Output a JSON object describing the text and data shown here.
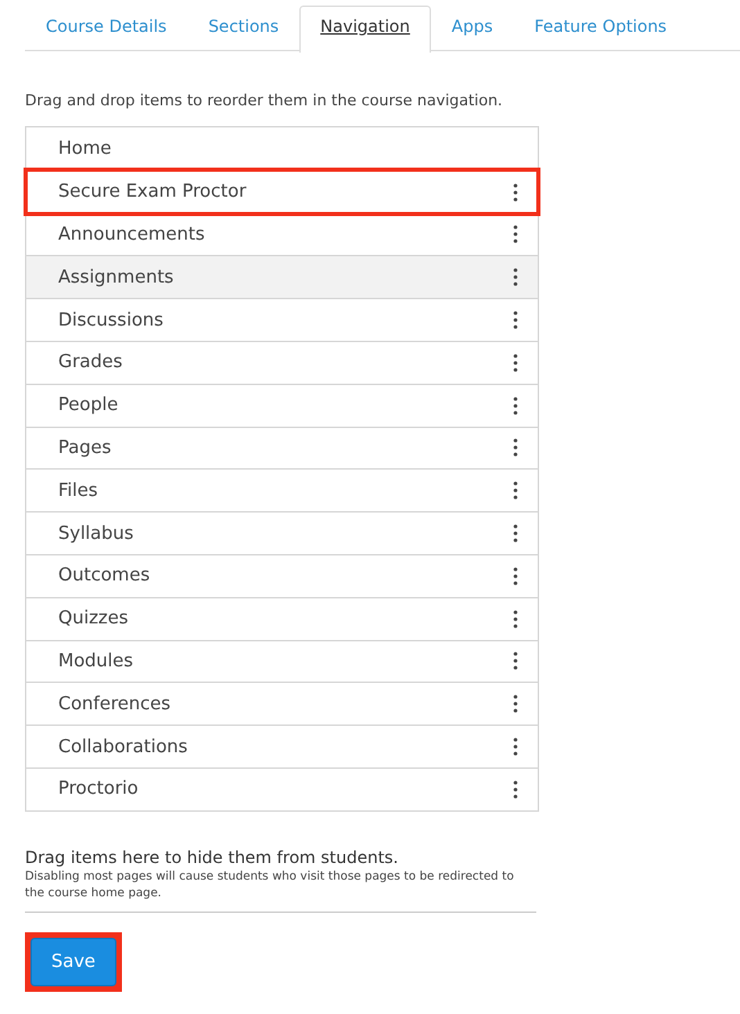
{
  "tabs": [
    {
      "label": "Course Details",
      "selected": false
    },
    {
      "label": "Sections",
      "selected": false
    },
    {
      "label": "Navigation",
      "selected": true
    },
    {
      "label": "Apps",
      "selected": false
    },
    {
      "label": "Feature Options",
      "selected": false
    }
  ],
  "instructions": "Drag and drop items to reorder them in the course navigation.",
  "nav_items": [
    {
      "label": "Home",
      "draggable": false,
      "highlighted": false,
      "shaded": false
    },
    {
      "label": "Secure Exam Proctor",
      "draggable": true,
      "highlighted": true,
      "shaded": false
    },
    {
      "label": "Announcements",
      "draggable": true,
      "highlighted": false,
      "shaded": false
    },
    {
      "label": "Assignments",
      "draggable": true,
      "highlighted": false,
      "shaded": true
    },
    {
      "label": "Discussions",
      "draggable": true,
      "highlighted": false,
      "shaded": false
    },
    {
      "label": "Grades",
      "draggable": true,
      "highlighted": false,
      "shaded": false
    },
    {
      "label": "People",
      "draggable": true,
      "highlighted": false,
      "shaded": false
    },
    {
      "label": "Pages",
      "draggable": true,
      "highlighted": false,
      "shaded": false
    },
    {
      "label": "Files",
      "draggable": true,
      "highlighted": false,
      "shaded": false
    },
    {
      "label": "Syllabus",
      "draggable": true,
      "highlighted": false,
      "shaded": false
    },
    {
      "label": "Outcomes",
      "draggable": true,
      "highlighted": false,
      "shaded": false
    },
    {
      "label": "Quizzes",
      "draggable": true,
      "highlighted": false,
      "shaded": false
    },
    {
      "label": "Modules",
      "draggable": true,
      "highlighted": false,
      "shaded": false
    },
    {
      "label": "Conferences",
      "draggable": true,
      "highlighted": false,
      "shaded": false
    },
    {
      "label": "Collaborations",
      "draggable": true,
      "highlighted": false,
      "shaded": false
    },
    {
      "label": "Proctorio",
      "draggable": true,
      "highlighted": false,
      "shaded": false
    }
  ],
  "hidden_zone": {
    "title": "Drag items here to hide them from students.",
    "note": "Disabling most pages will cause students who visit those pages to be redirected to the course home page."
  },
  "save_button": {
    "label": "Save",
    "highlighted": true
  }
}
